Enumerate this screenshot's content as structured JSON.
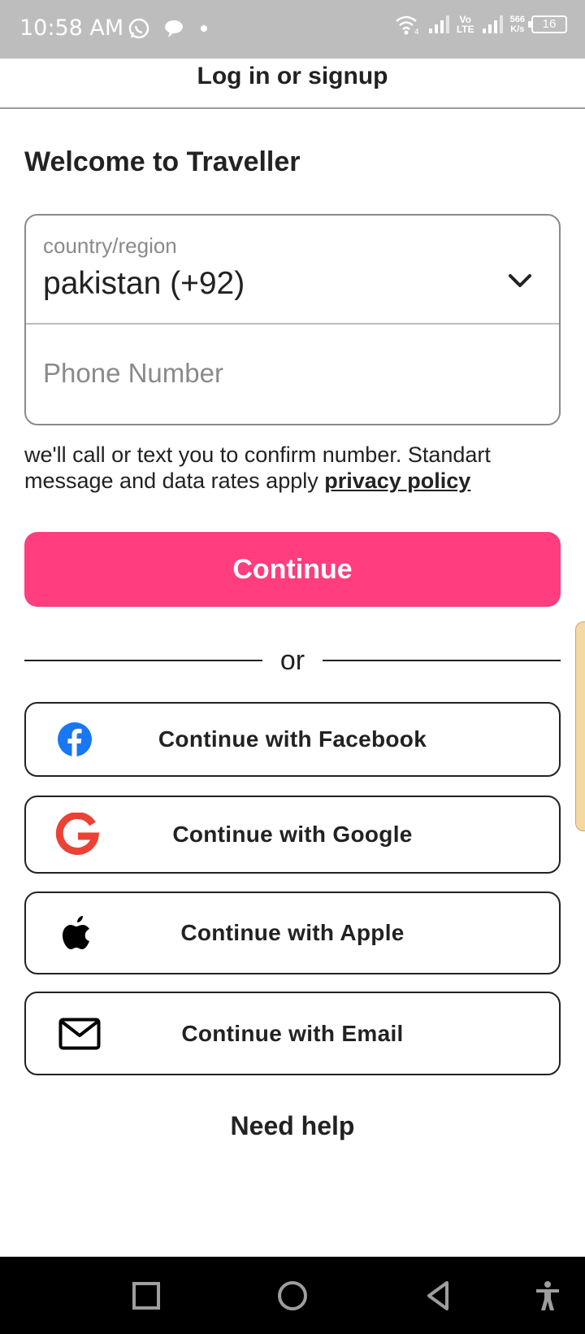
{
  "status_bar": {
    "time": "10:58 AM",
    "network_speed_value": "566",
    "network_speed_unit": "K/s",
    "volte_top": "Vo",
    "volte_bottom": "LTE",
    "battery": "16",
    "icons": [
      "whatsapp-icon",
      "chat-bubble-icon",
      "dot-icon",
      "wifi-icon",
      "signal-icon",
      "signal-icon",
      "battery-icon"
    ]
  },
  "header": {
    "title": "Log in or signup"
  },
  "welcome": "Welcome to Traveller",
  "country_field": {
    "label": "country/region",
    "value": "pakistan (+92)"
  },
  "phone_field": {
    "placeholder": "Phone Number"
  },
  "disclaimer": {
    "text": "we'll call or text you to confirm number. Standart message and data rates apply ",
    "link": "privacy policy"
  },
  "continue_button": "Continue",
  "divider_text": "or",
  "social_buttons": [
    {
      "label": "Continue with Facebook",
      "icon": "facebook-icon"
    },
    {
      "label": "Continue with Google",
      "icon": "google-icon"
    },
    {
      "label": "Continue with Apple",
      "icon": "apple-icon"
    },
    {
      "label": "Continue with Email",
      "icon": "email-icon"
    }
  ],
  "help": "Need help",
  "colors": {
    "accent": "#ff3d7f",
    "status_bar": "#bdbdbd",
    "facebook": "#1877f2",
    "google": "#ea4335"
  }
}
